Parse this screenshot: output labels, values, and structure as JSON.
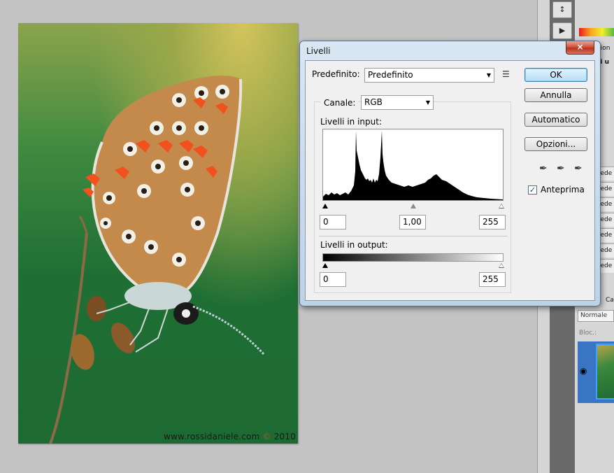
{
  "photo": {
    "watermark_site": "www.rossidaniele.com",
    "watermark_symbol": "©",
    "watermark_year": "2010"
  },
  "right_panel": {
    "panel_label_1": "zion",
    "panel_label_2": "gi u",
    "preset_items": [
      "rede",
      "rede",
      "rede",
      "rede",
      "rede",
      "rede",
      "rede"
    ],
    "tab_label": "Ca",
    "blend_mode": "Normale",
    "lock_label": "Bloc.:"
  },
  "dialog": {
    "title": "Livelli",
    "close_glyph": "×",
    "preset_label": "Predefinito:",
    "preset_value": "Predefinito",
    "channel_label": "Canale:",
    "channel_value": "RGB",
    "input_levels_label": "Livelli in input:",
    "input_black": "0",
    "input_gamma": "1,00",
    "input_white": "255",
    "output_levels_label": "Livelli in output:",
    "output_black": "0",
    "output_white": "255",
    "buttons": {
      "ok": "OK",
      "cancel": "Annulla",
      "auto": "Automatico",
      "options": "Opzioni..."
    },
    "preview_label": "Anteprima",
    "preview_checked": true
  },
  "colors": {
    "dialog_accent": "#3c7fb1",
    "close_button": "#c43a25"
  }
}
